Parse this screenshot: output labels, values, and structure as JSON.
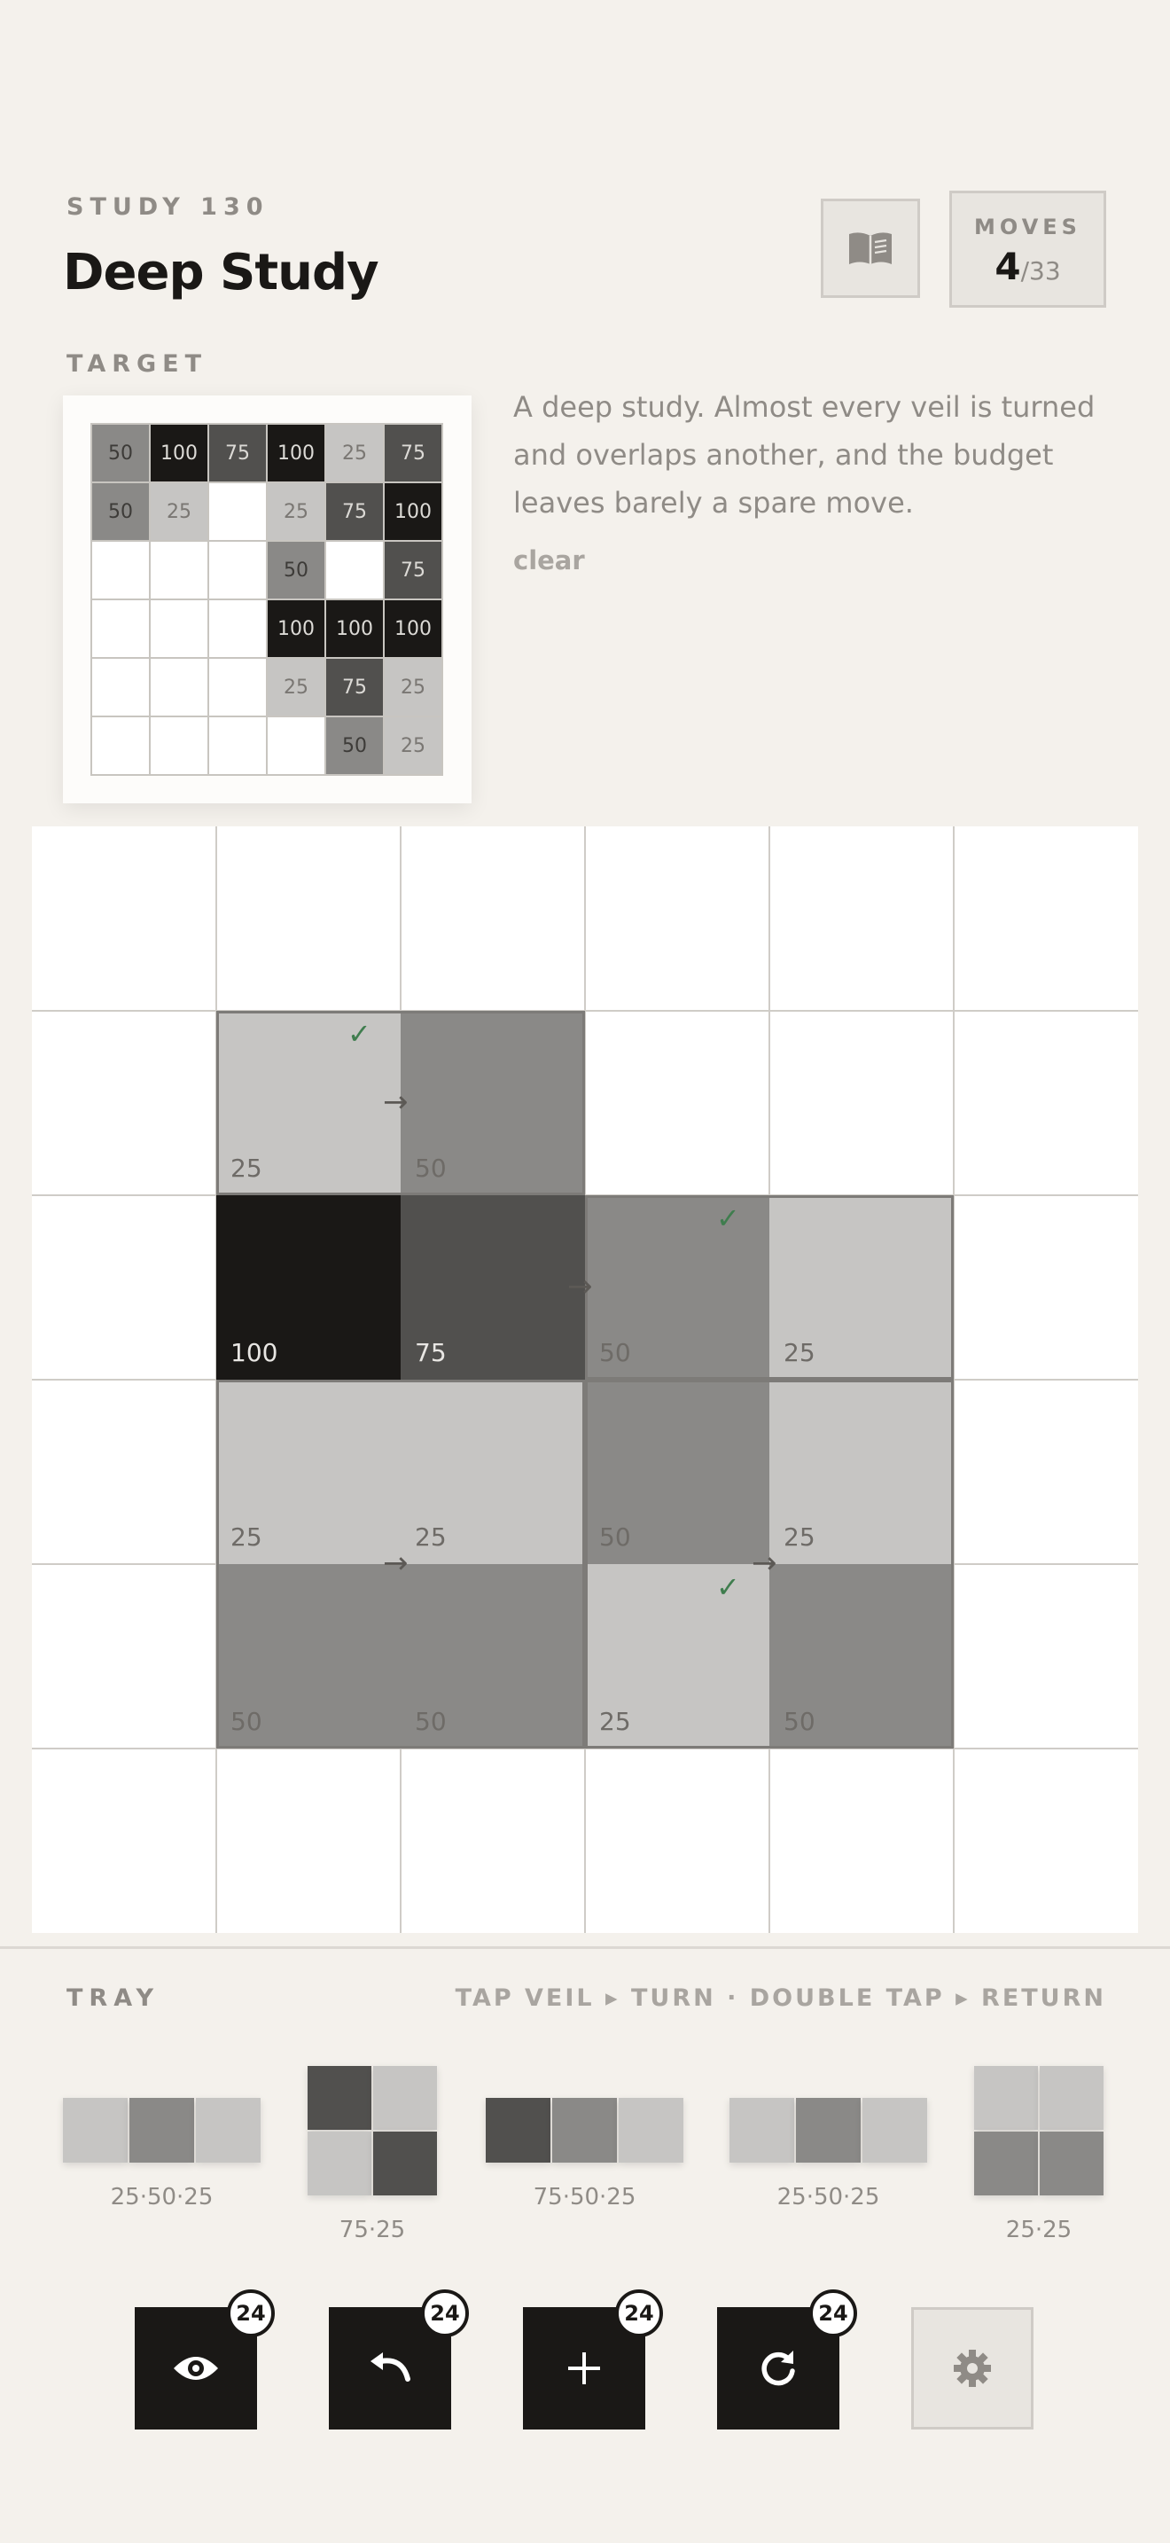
{
  "header": {
    "study_label": "STUDY 130",
    "title": "Deep Study",
    "moves_label": "MOVES",
    "moves_current": "4",
    "moves_total": "/33"
  },
  "target": {
    "label": "TARGET",
    "grid": [
      [
        "50",
        "100",
        "75",
        "100",
        "25",
        "75"
      ],
      [
        "50",
        "25",
        "",
        "25",
        "75",
        "100"
      ],
      [
        "",
        "",
        "",
        "50",
        "",
        "75"
      ],
      [
        "",
        "",
        "",
        "100",
        "100",
        "100"
      ],
      [
        "",
        "",
        "",
        "25",
        "75",
        "25"
      ],
      [
        "",
        "",
        "",
        "",
        "50",
        "25"
      ]
    ]
  },
  "description": {
    "text": "A deep study. Almost every veil is turned and overlaps another, and the budget leaves barely a spare move.",
    "clear_label": "clear"
  },
  "board": {
    "size": 6,
    "cells": [
      {
        "row": 1,
        "col": 1,
        "value": "25",
        "shade": "#c6c5c3"
      },
      {
        "row": 1,
        "col": 2,
        "value": "50",
        "shade": "#8a8987"
      },
      {
        "row": 2,
        "col": 1,
        "value": "100",
        "shade": "#1a1816"
      },
      {
        "row": 2,
        "col": 2,
        "value": "75",
        "shade": "#51504e"
      },
      {
        "row": 2,
        "col": 3,
        "value": "50",
        "shade": "#8a8987"
      },
      {
        "row": 2,
        "col": 4,
        "value": "25",
        "shade": "#c6c5c3"
      },
      {
        "row": 3,
        "col": 1,
        "value": "25",
        "shade": "#c6c5c3"
      },
      {
        "row": 3,
        "col": 2,
        "value": "25",
        "shade": "#c6c5c3"
      },
      {
        "row": 3,
        "col": 3,
        "value": "50",
        "shade": "#8a8987"
      },
      {
        "row": 3,
        "col": 4,
        "value": "25",
        "shade": "#c6c5c3"
      },
      {
        "row": 4,
        "col": 1,
        "value": "50",
        "shade": "#8a8987"
      },
      {
        "row": 4,
        "col": 2,
        "value": "50",
        "shade": "#8a8987"
      },
      {
        "row": 4,
        "col": 3,
        "value": "25",
        "shade": "#c6c5c3"
      },
      {
        "row": 4,
        "col": 4,
        "value": "50",
        "shade": "#8a8987"
      }
    ],
    "veils": [
      {
        "row": 1,
        "col": 1,
        "rows": 1,
        "cols": 2
      },
      {
        "row": 2,
        "col": 3,
        "rows": 1,
        "cols": 2
      },
      {
        "row": 3,
        "col": 1,
        "rows": 2,
        "cols": 2
      },
      {
        "row": 3,
        "col": 3,
        "rows": 2,
        "cols": 2
      }
    ],
    "arrows": [
      {
        "row": 1,
        "col": 2,
        "edge": "left",
        "vpos": 0.5
      },
      {
        "row": 2,
        "col": 3,
        "edge": "left",
        "vpos": 0.5
      },
      {
        "row": 4,
        "col": 2,
        "edge": "left",
        "vpos": 0.0
      },
      {
        "row": 4,
        "col": 4,
        "edge": "left",
        "vpos": 0.0
      }
    ],
    "checks": [
      {
        "row": 1,
        "col": 1
      },
      {
        "row": 2,
        "col": 3
      },
      {
        "row": 4,
        "col": 3
      }
    ]
  },
  "tray": {
    "label": "TRAY",
    "hint": "TAP VEIL ▸ TURN · DOUBLE TAP ▸ RETURN",
    "pieces": [
      {
        "caption": "25·50·25",
        "cols": 3,
        "rows": 1,
        "shades": [
          "#c6c5c3",
          "#8a8987",
          "#c6c5c3"
        ]
      },
      {
        "caption": "75·25",
        "cols": 2,
        "rows": 2,
        "shades": [
          "#51504e",
          "#c6c5c3",
          "#c6c5c3",
          "#51504e"
        ]
      },
      {
        "caption": "75·50·25",
        "cols": 3,
        "rows": 1,
        "shades": [
          "#51504e",
          "#8a8987",
          "#c6c5c3"
        ]
      },
      {
        "caption": "25·50·25",
        "cols": 3,
        "rows": 1,
        "shades": [
          "#c6c5c3",
          "#8a8987",
          "#c6c5c3"
        ]
      },
      {
        "caption": "25·25",
        "cols": 2,
        "rows": 2,
        "shades": [
          "#c6c5c3",
          "#c6c5c3",
          "#8a8987",
          "#8a8987"
        ]
      }
    ]
  },
  "actions": [
    {
      "name": "peek",
      "icon": "eye-icon",
      "count": "24"
    },
    {
      "name": "undo",
      "icon": "undo-icon",
      "count": "24"
    },
    {
      "name": "add",
      "icon": "plus-icon",
      "count": "24"
    },
    {
      "name": "reset",
      "icon": "refresh-icon",
      "count": "24"
    }
  ],
  "settings_icon": "gear-icon",
  "colors": {
    "background": "#f4f1ec",
    "ink": "#1a1816",
    "muted": "#8f8b86",
    "check": "#3f7d4e"
  }
}
